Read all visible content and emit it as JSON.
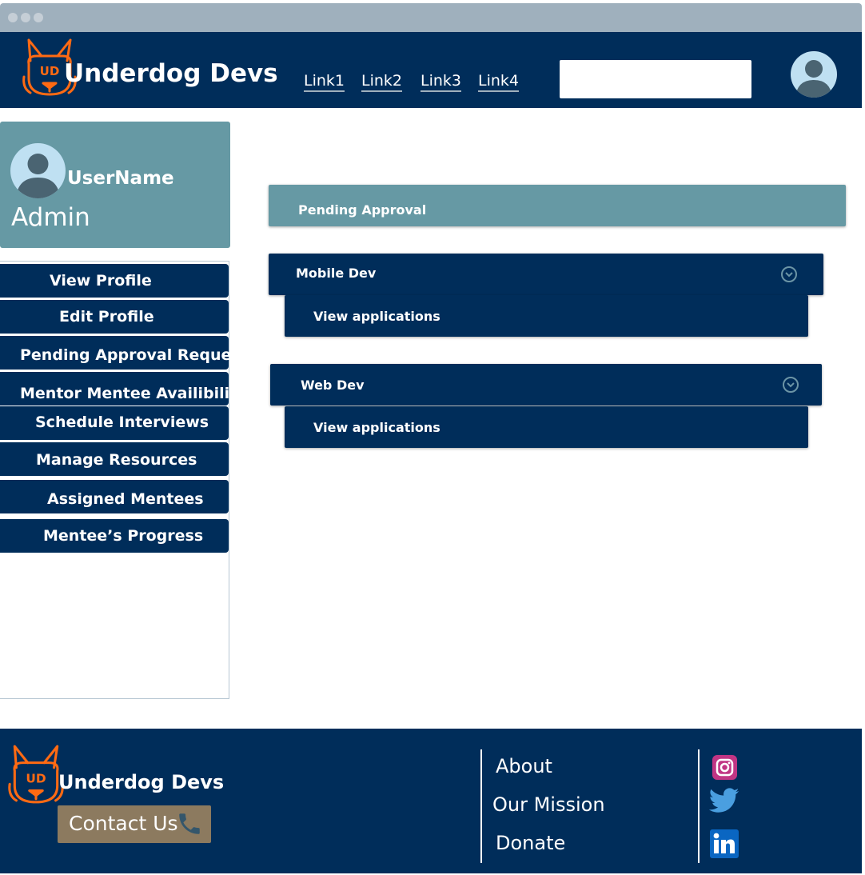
{
  "header": {
    "brand": "Underdog Devs",
    "logo_text": "UD",
    "nav_links": [
      "Link1",
      "Link2",
      "Link3",
      "Link4"
    ],
    "search_placeholder": ""
  },
  "sidebar": {
    "username": "UserName",
    "role": "Admin",
    "menu": [
      "View Profile",
      "Edit Profile",
      "Pending Approval Requests",
      "Mentor Mentee Availibility",
      "Schedule Interviews",
      "Manage Resources",
      "Assigned Mentees",
      "Mentee’s Progress"
    ]
  },
  "main": {
    "section_title": "Pending Approval",
    "groups": [
      {
        "title": "Mobile Dev",
        "action": "View applications"
      },
      {
        "title": "Web Dev",
        "action": "View applications"
      }
    ]
  },
  "footer": {
    "brand": "Underdog Devs",
    "logo_text": "UD",
    "contact_label": "Contact Us",
    "links": [
      "About",
      "Our Mission",
      "Donate"
    ],
    "social_icons": [
      "instagram-icon",
      "twitter-icon",
      "linkedin-icon"
    ]
  },
  "colors": {
    "navy": "#002d5a",
    "teal": "#6699a4",
    "logo_orange": "#ff6a13",
    "contact_bg": "#8c7a5f",
    "instagram": "#c13584",
    "twitter": "#1da1f2",
    "linkedin": "#0a66c2"
  }
}
